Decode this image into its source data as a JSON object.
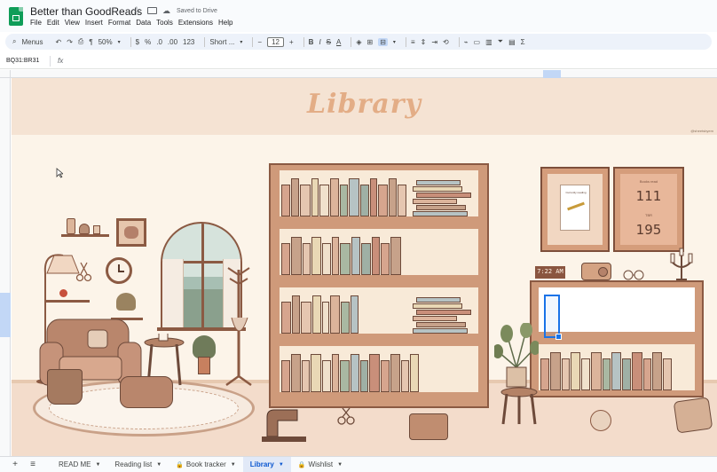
{
  "app": {
    "title": "Better than GoodReads",
    "saved_status": "Saved to Drive"
  },
  "menu": [
    "File",
    "Edit",
    "View",
    "Insert",
    "Format",
    "Data",
    "Tools",
    "Extensions",
    "Help"
  ],
  "toolbar": {
    "search_label": "Menus",
    "zoom": "50%",
    "currency": "$",
    "percent": "%",
    "decimal_dec": ".0",
    "decimal_inc": ".00",
    "number_format": "123",
    "font": "Short ...",
    "font_size": "12"
  },
  "formula_bar": {
    "name_box": "BQ31:BR31",
    "fx": "fx"
  },
  "sheet": {
    "title": "Library",
    "credit": "@sheetsbyem",
    "stats": {
      "label_a": "Books read",
      "value_a": "111",
      "label_b": "TBR",
      "value_b": "195"
    },
    "clock": "7:22 AM",
    "poster_text": "Currently reading"
  },
  "tabs": [
    {
      "label": "READ ME",
      "locked": false,
      "active": false
    },
    {
      "label": "Reading list",
      "locked": false,
      "active": false
    },
    {
      "label": "Book tracker",
      "locked": true,
      "active": false
    },
    {
      "label": "Library",
      "locked": false,
      "active": true
    },
    {
      "label": "Wishlist",
      "locked": true,
      "active": false
    }
  ],
  "colors": {
    "accent": "#0b57d0",
    "banner": "#f5e3d3",
    "title": "#e3ad86",
    "wood": "#cf9a7a"
  }
}
